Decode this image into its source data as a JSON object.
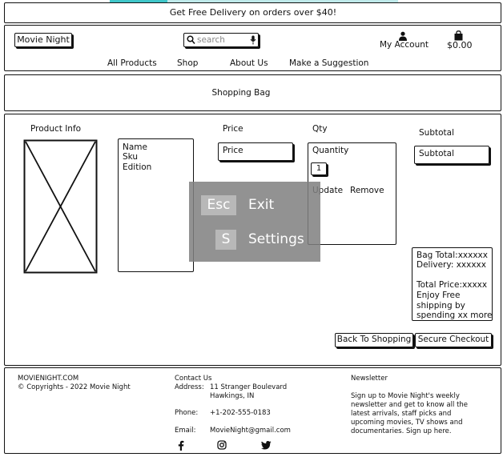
{
  "banner": {
    "text": "Get Free Delivery on orders over $40!"
  },
  "header": {
    "logo": "Movie Night",
    "search_placeholder": "search",
    "account_label": "My Account",
    "bag_total": "$0.00",
    "nav": [
      "All Products",
      "Shop",
      "About Us",
      "Make a Suggestion"
    ]
  },
  "page_title": "Shopping Bag",
  "bag": {
    "headers": {
      "product_info": "Product Info",
      "price": "Price",
      "qty": "Qty",
      "subtotal": "Subtotal"
    },
    "item": {
      "name": "Name",
      "sku": "Sku",
      "edition": "Edition",
      "price": "Price",
      "quantity_label": "Quantity",
      "quantity_value": "1",
      "update": "Update",
      "remove": "Remove",
      "subtotal": "Subtotal"
    },
    "summary": {
      "bag_total": "Bag Total:xxxxxx",
      "delivery": "Delivery: xxxxxx",
      "total_price": "Total Price:xxxxx",
      "free_line1": "Enjoy Free",
      "free_line2": "shipping by",
      "free_line3": "spending xx more"
    },
    "back_button": "Back To Shopping",
    "checkout_button": "Secure Checkout"
  },
  "overlay": {
    "esc_key": "Esc",
    "esc_label": "Exit",
    "s_key": "S",
    "s_label": "Settings"
  },
  "footer": {
    "site": "MOVIENIGHT.COM",
    "copyright": "© Copyrights - 2022 Movie Night",
    "contact_heading": "Contact Us",
    "address_label": "Address:",
    "address_line1": "11 Stranger Boulevard",
    "address_line2": "Hawkings, IN",
    "phone_label": "Phone:",
    "phone": "+1-202-555-0183",
    "email_label": "Email:",
    "email": "MovieNight@gmail.com",
    "newsletter_heading": "Newsletter",
    "newsletter_line1": "Sign up to Movie Night's weekly",
    "newsletter_line2": "newsletter and get to know all the",
    "newsletter_line3": "latest arrivals, staff picks and",
    "newsletter_line4": "upcoming movies, TV shows and",
    "newsletter_line5": "documentaries. Sign up here."
  }
}
